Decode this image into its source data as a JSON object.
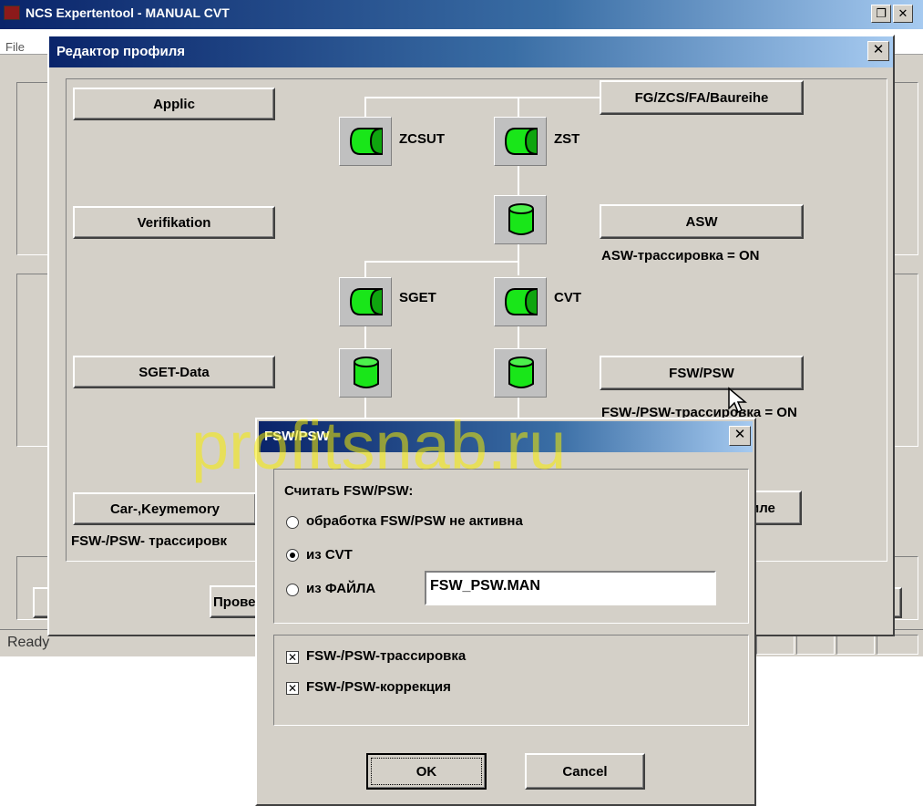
{
  "main_window": {
    "title": "NCS Expertentool - MANUAL CVT",
    "menu_file": "File",
    "status": "Ready",
    "behind_button": "Прове"
  },
  "editor": {
    "title": "Редактор профиля",
    "buttons": {
      "applic": "Applic",
      "verifikation": "Verifikation",
      "sget_data": "SGET-Data",
      "car_keymemory": "Car-,Keymemory",
      "fg_zcs": "FG/ZCS/FA/Baureihe",
      "asw": "ASW",
      "fsw_psw": "FSW/PSW",
      "file_partial": "иле"
    },
    "labels": {
      "asw_trace": "ASW-трассировка = ON",
      "fsw_trace": "FSW-/PSW-трассировка = ON",
      "car_trace": "FSW-/PSW- трассировк"
    },
    "nodes": {
      "zcsut": "ZCSUT",
      "zst": "ZST",
      "sget": "SGET",
      "cvt": "CVT"
    }
  },
  "fsw_dialog": {
    "title": "FSW/PSW",
    "group_label": "Считать FSW/PSW:",
    "options": [
      {
        "label": "обработка FSW/PSW не активна",
        "selected": false
      },
      {
        "label": "из CVT",
        "selected": true
      },
      {
        "label": "из ФАЙЛА",
        "selected": false
      }
    ],
    "file_value": "FSW_PSW.MAN",
    "checkboxes": [
      {
        "label": "FSW-/PSW-трассировка",
        "checked": true
      },
      {
        "label": "FSW-/PSW-коррекция",
        "checked": true
      }
    ],
    "ok": "OK",
    "cancel": "Cancel"
  },
  "watermark": "profitsnab.ru",
  "colors": {
    "titlebar_dark": "#0a246a",
    "titlebar_light": "#a6caf0",
    "node_green": "#19e619",
    "face": "#d4d0c8"
  },
  "icons": [
    "close-icon",
    "restore-icon",
    "process-node-icon",
    "database-icon",
    "radio-icon",
    "checkbox-icon",
    "mouse-cursor-icon"
  ]
}
